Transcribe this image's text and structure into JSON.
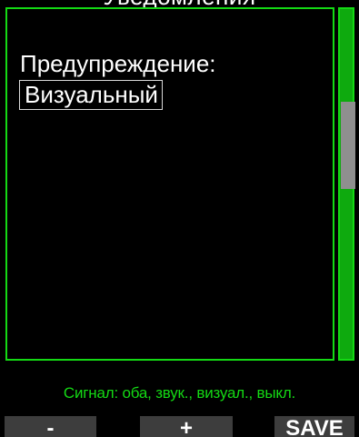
{
  "header": {
    "title": "Уведомления"
  },
  "setting": {
    "label": "Предупреждение:",
    "value": "Визуальный"
  },
  "hint": {
    "text": "Сигнал: оба, звук., визуал., выкл."
  },
  "softkeys": {
    "minus": "-",
    "plus": "+",
    "save": "SAVE"
  },
  "colors": {
    "accent_green": "#14d914",
    "scrollbar_green": "#0eaa0e",
    "scroll_thumb": "#8f8f8f",
    "softkey_bg": "#3d3d3d",
    "background": "#000000",
    "text": "#ffffff"
  }
}
